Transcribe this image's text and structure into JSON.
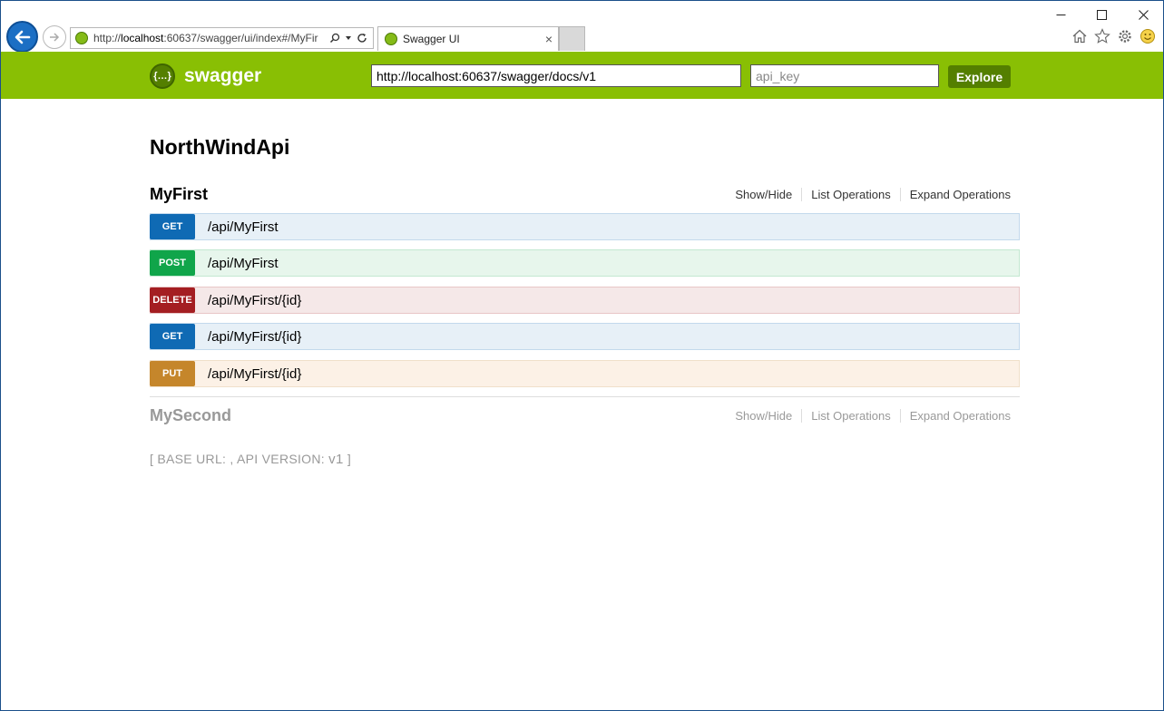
{
  "browser": {
    "address_host_prefix": "http://",
    "address_host": "localhost",
    "address_rest": ":60637/swagger/ui/index#/MyFir",
    "tab_title": "Swagger UI",
    "tab_close": "×"
  },
  "window_controls": {
    "minimize": "—",
    "maximize": "☐",
    "close": "✕"
  },
  "header": {
    "logo_mark": "{…}",
    "logo_text": "swagger",
    "url_value": "http://localhost:60637/swagger/docs/v1",
    "api_key_placeholder": "api_key",
    "explore_label": "Explore"
  },
  "api": {
    "title": "NorthWindApi",
    "resources": [
      {
        "name": "MyFirst",
        "ops_labels": [
          "Show/Hide",
          "List Operations",
          "Expand Operations"
        ],
        "operations": [
          {
            "method": "GET",
            "path": "/api/MyFirst"
          },
          {
            "method": "POST",
            "path": "/api/MyFirst"
          },
          {
            "method": "DELETE",
            "path": "/api/MyFirst/{id}"
          },
          {
            "method": "GET",
            "path": "/api/MyFirst/{id}"
          },
          {
            "method": "PUT",
            "path": "/api/MyFirst/{id}"
          }
        ]
      },
      {
        "name": "MySecond",
        "ops_labels": [
          "Show/Hide",
          "List Operations",
          "Expand Operations"
        ]
      }
    ],
    "footer_text": "[ BASE URL: , API VERSION: ",
    "footer_version": "v1",
    "footer_close": " ]"
  },
  "colors": {
    "header_bg": "#89bf04",
    "get": "#0f6ab4",
    "post": "#10a54a",
    "delete": "#a41e22",
    "put": "#c5862b"
  }
}
